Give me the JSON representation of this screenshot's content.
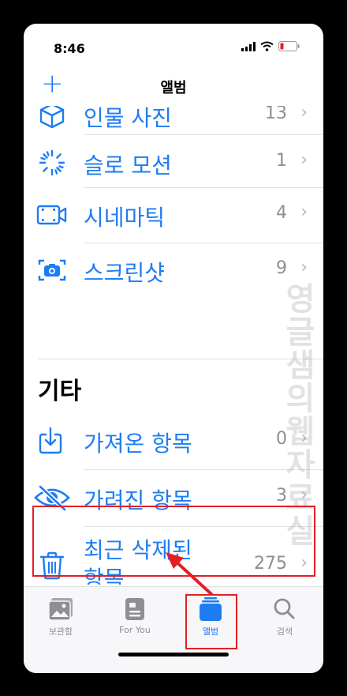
{
  "status_bar": {
    "time": "8:46"
  },
  "nav": {
    "add_symbol": "+",
    "title": "앨범"
  },
  "media_types": [
    {
      "label": "인물 사진",
      "count": "13",
      "icon": "cube-icon"
    },
    {
      "label": "슬로 모션",
      "count": "1",
      "icon": "slow-motion-icon"
    },
    {
      "label": "시네마틱",
      "count": "4",
      "icon": "cinematic-icon"
    },
    {
      "label": "스크린샷",
      "count": "9",
      "icon": "screenshot-icon"
    }
  ],
  "other_section": {
    "title": "기타",
    "items": [
      {
        "label": "가져온 항목",
        "count": "0",
        "icon": "import-icon"
      },
      {
        "label": "가려진 항목",
        "count": "3",
        "icon": "hidden-eye-icon"
      },
      {
        "label_line1": "최근 삭제된",
        "label_line2": "항목",
        "count": "275",
        "icon": "trash-icon"
      }
    ]
  },
  "chevron": "›",
  "watermark": [
    "영",
    "글",
    "샘",
    "의",
    "웹",
    "자",
    "료",
    "실"
  ],
  "tabs": [
    {
      "label": "보관함",
      "icon": "library-icon",
      "active": false
    },
    {
      "label": "For You",
      "icon": "for-you-icon",
      "active": false
    },
    {
      "label": "앨범",
      "icon": "albums-icon",
      "active": true
    },
    {
      "label": "검색",
      "icon": "search-icon",
      "active": false
    }
  ],
  "colors": {
    "accent": "#1e7cf2",
    "highlight": "#e31f26",
    "secondary_text": "#8e8e93"
  }
}
